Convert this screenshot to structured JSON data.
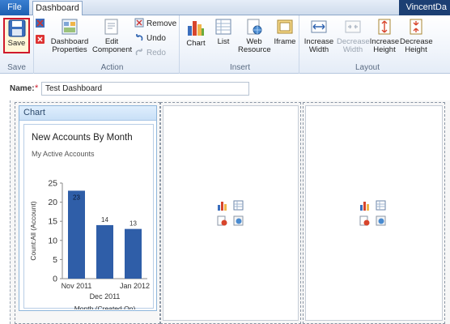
{
  "tabs": {
    "file": "File",
    "active": "Dashboard"
  },
  "user": {
    "name": "VincentDa"
  },
  "ribbon": {
    "save": {
      "buttons": {
        "save": "Save"
      },
      "label": "Save"
    },
    "action": {
      "buttons": {
        "dashboard_properties": [
          "Dashboard",
          "Properties"
        ],
        "edit_component": [
          "Edit",
          "Component"
        ],
        "remove": "Remove",
        "undo": "Undo",
        "redo": "Redo"
      },
      "label": "Action"
    },
    "insert": {
      "buttons": {
        "chart": "Chart",
        "list": "List",
        "web_resource": [
          "Web",
          "Resource"
        ],
        "iframe": "Iframe"
      },
      "label": "Insert"
    },
    "layout": {
      "buttons": {
        "increase_width": [
          "Increase",
          "Width"
        ],
        "decrease_width": [
          "Decrease",
          "Width"
        ],
        "increase_height": [
          "Increase",
          "Height"
        ],
        "decrease_height": [
          "Decrease",
          "Height"
        ]
      },
      "label": "Layout"
    }
  },
  "form": {
    "name_label": "Name:",
    "required_mark": "*",
    "name_value": "Test Dashboard"
  },
  "panel": {
    "header": "Chart"
  },
  "colors": {
    "bar": "#2f5ea8",
    "accent": "#d0192b"
  },
  "chart_data": {
    "type": "bar",
    "title": "New Accounts By Month",
    "subtitle": "My Active Accounts",
    "categories": [
      "Nov 2011",
      "Dec 2011",
      "Jan 2012"
    ],
    "values": [
      23,
      14,
      13
    ],
    "data_labels": [
      "23",
      "14",
      "13"
    ],
    "ylabel": "Count:All (Account)",
    "xlabel": "Month (Created On)",
    "ylim": [
      0,
      25
    ],
    "yticks": [
      0,
      5,
      10,
      15,
      20,
      25
    ],
    "grid": false,
    "legend": "none"
  }
}
